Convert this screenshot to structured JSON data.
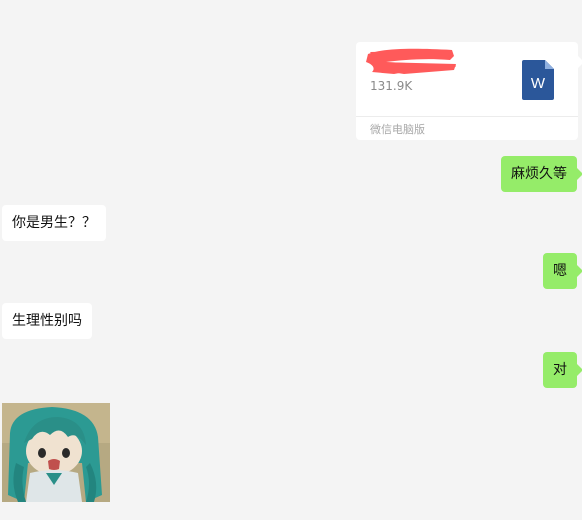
{
  "messages": {
    "file": {
      "size": "131.9K",
      "source": "微信电脑版",
      "icon": "word-document-icon",
      "icon_letter": "W",
      "icon_color": "#2b579a",
      "redaction_color": "#ff5a5a"
    },
    "sent_1": "麻烦久等",
    "received_1": "你是男生？？",
    "sent_2": "嗯",
    "received_2": "生理性别吗",
    "sent_3": "对",
    "sticker": "anime-figure-sticker"
  },
  "colors": {
    "background": "#f4f4f4",
    "sent_bubble": "#95ec69",
    "received_bubble": "#ffffff"
  }
}
